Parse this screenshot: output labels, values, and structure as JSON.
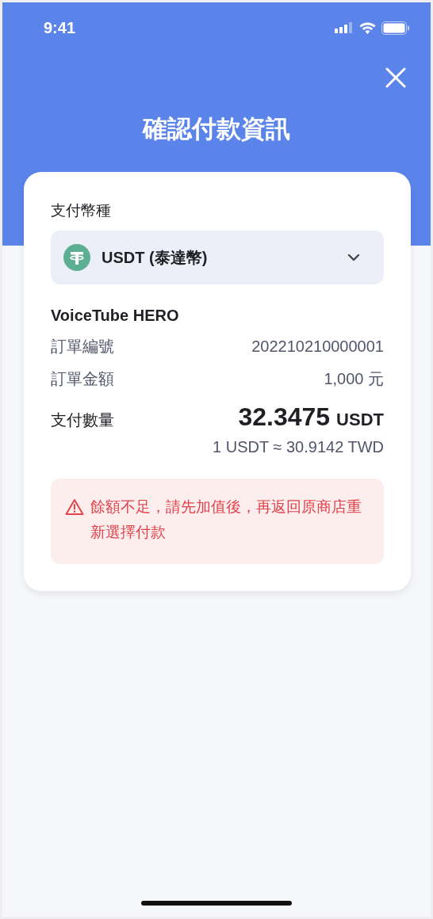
{
  "status_bar": {
    "time": "9:41"
  },
  "header": {
    "title": "確認付款資訊"
  },
  "currency": {
    "label": "支付幣種",
    "value": "USDT (泰達幣)"
  },
  "merchant": "VoiceTube HERO",
  "details": [
    {
      "label": "訂單編號",
      "value": "202210210000001"
    },
    {
      "label": "訂單金額",
      "value": "1,000 元"
    }
  ],
  "payment": {
    "label": "支付數量",
    "amount": "32.3475",
    "unit": "USDT",
    "rate": "1 USDT ≈ 30.9142 TWD"
  },
  "warning": {
    "message": "餘額不足，請先加值後，再返回原商店重新選擇付款"
  }
}
